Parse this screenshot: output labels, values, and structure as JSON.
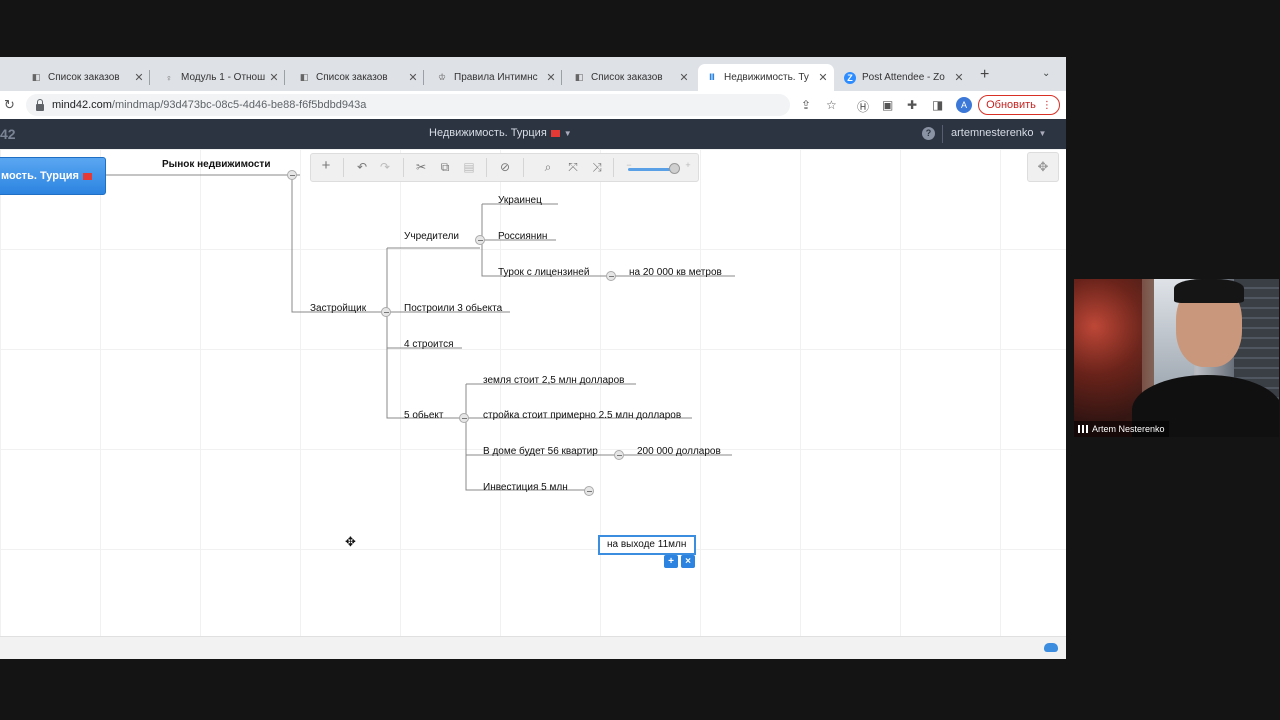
{
  "browser": {
    "tabs": [
      {
        "label": "Список заказов",
        "icon": "notion-icon",
        "active": false
      },
      {
        "label": "Модуль 1 - Отнош",
        "icon": "bulb-icon",
        "active": false
      },
      {
        "label": "Список заказов",
        "icon": "notion-icon",
        "active": false
      },
      {
        "label": "Правила Интимнс",
        "icon": "trophy-icon",
        "active": false
      },
      {
        "label": "Список заказов",
        "icon": "notion-icon",
        "active": false
      },
      {
        "label": "Недвижимость. Ту",
        "icon": "mind42-icon",
        "active": true
      },
      {
        "label": "Post Attendee - Zo",
        "icon": "zoom-icon",
        "active": false
      }
    ],
    "new_tab_symbol": "+",
    "url_host": "mind42.com",
    "url_path": "/mindmap/93d473bc-08c5-4d46-be88-f6f5bdbd943a",
    "update_button": "Обновить",
    "profile_initial": "A"
  },
  "app": {
    "logo": "42",
    "map_title": "Недвижимость. Турция",
    "help": "?",
    "username": "artemnesterenko"
  },
  "mindmap": {
    "root": "мость. Турция",
    "nodes": {
      "market": "Рынок недвижимости",
      "developer": "Застройщик",
      "founders": "Учредители",
      "ukrainian": "Украинец",
      "russian": "Россиянин",
      "turk": "Турок с лицензиней",
      "area": "на 20 000 кв метров",
      "built": "Построили 3 обьекта",
      "building": "4 строится",
      "fifth": "5 обьект",
      "land": "земля стоит 2,5 млн долларов",
      "construction": "стройка стоит примерно 2.5 млн долларов",
      "apartments": "В доме будет 56 квартир",
      "price": "200 000 долларов",
      "investment": "Инвестиция 5 млн",
      "exit": "на выходе 11млн"
    }
  },
  "webcam": {
    "participant_name": "Artem Nesterenko"
  },
  "colors": {
    "root_node": "#2c84e0",
    "app_header": "#2c3442",
    "update_button": "#d93025"
  }
}
